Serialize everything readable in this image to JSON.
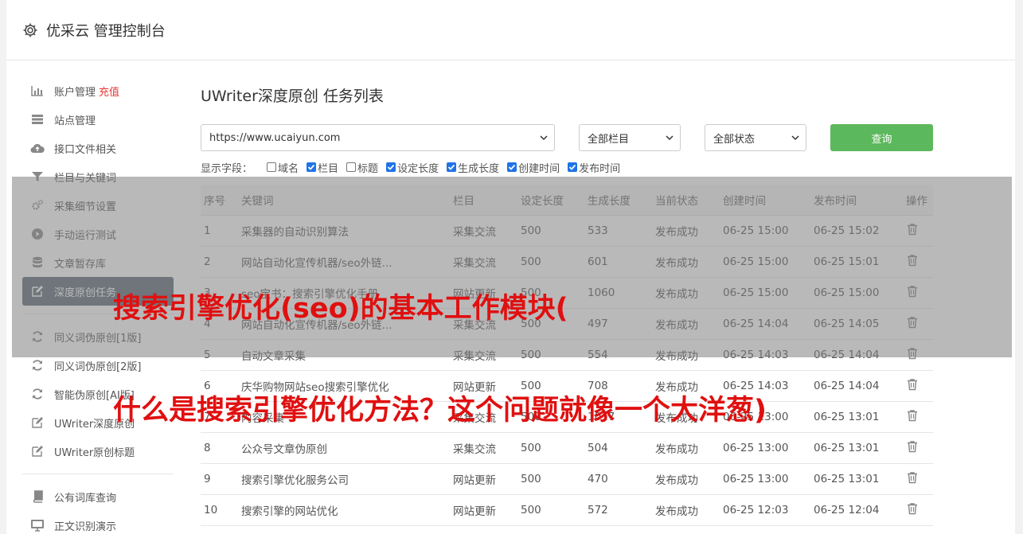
{
  "header": {
    "title": "优采云 管理控制台"
  },
  "sidebar": {
    "items": [
      {
        "label": "账户管理",
        "badge": "充值",
        "icon": "bar-chart-icon"
      },
      {
        "label": "站点管理",
        "icon": "server-icon"
      },
      {
        "label": "接口文件相关",
        "icon": "cloud-upload-icon"
      },
      {
        "label": "栏目与关键词",
        "icon": "filter-icon"
      },
      {
        "label": "采集细节设置",
        "icon": "gears-icon"
      },
      {
        "label": "手动运行测试",
        "icon": "play-icon"
      },
      {
        "label": "文章暂存库",
        "icon": "database-icon"
      },
      {
        "label": "深度原创任务",
        "icon": "edit-icon"
      }
    ],
    "items2": [
      {
        "label": "同义词伪原创[1版]",
        "icon": "refresh-icon"
      },
      {
        "label": "同义词伪原创[2版]",
        "icon": "refresh-icon"
      },
      {
        "label": "智能伪原创[AI版]",
        "icon": "refresh-icon"
      },
      {
        "label": "UWriter深度原创",
        "icon": "edit-icon"
      },
      {
        "label": "UWriter原创标题",
        "icon": "edit-icon"
      }
    ],
    "items3": [
      {
        "label": "公有词库查询",
        "icon": "book-icon"
      },
      {
        "label": "正文识别演示",
        "icon": "monitor-icon"
      }
    ]
  },
  "main": {
    "title": "UWriter深度原创 任务列表",
    "filters": {
      "site": "https://www.ucaiyun.com",
      "column": "全部栏目",
      "status": "全部状态",
      "query_label": "查询"
    },
    "fields": {
      "label": "显示字段：",
      "options": [
        {
          "label": "域名",
          "checked": false
        },
        {
          "label": "栏目",
          "checked": true
        },
        {
          "label": "标题",
          "checked": false
        },
        {
          "label": "设定长度",
          "checked": true
        },
        {
          "label": "生成长度",
          "checked": true
        },
        {
          "label": "创建时间",
          "checked": true
        },
        {
          "label": "发布时间",
          "checked": true
        }
      ]
    },
    "table": {
      "headers": [
        "序号",
        "关键词",
        "栏目",
        "设定长度",
        "生成长度",
        "当前状态",
        "创建时间",
        "发布时间",
        "操作"
      ],
      "rows": [
        [
          "1",
          "采集器的自动识别算法",
          "采集交流",
          "500",
          "533",
          "发布成功",
          "06-25 15:00",
          "06-25 15:02"
        ],
        [
          "2",
          "网站自动化宣传机器/seo外链...",
          "采集交流",
          "500",
          "601",
          "发布成功",
          "06-25 15:00",
          "06-25 15:01"
        ],
        [
          "3",
          "seo宝书：搜索引擎优化手册",
          "网站更新",
          "500",
          "1060",
          "发布成功",
          "06-25 15:00",
          "06-25 15:00"
        ],
        [
          "4",
          "网站自动化宣传机器/seo外链...",
          "采集交流",
          "500",
          "497",
          "发布成功",
          "06-25 14:04",
          "06-25 14:05"
        ],
        [
          "5",
          "自动文章采集",
          "采集交流",
          "500",
          "554",
          "发布成功",
          "06-25 14:03",
          "06-25 14:04"
        ],
        [
          "6",
          "庆华购物网站seo搜索引擎优化",
          "网站更新",
          "500",
          "708",
          "发布成功",
          "06-25 14:03",
          "06-25 14:04"
        ],
        [
          "7",
          "内容采集",
          "采集交流",
          "500",
          "1017",
          "发布成功",
          "06-25 13:00",
          "06-25 13:01"
        ],
        [
          "8",
          "公众号文章伪原创",
          "采集交流",
          "500",
          "504",
          "发布成功",
          "06-25 13:00",
          "06-25 13:01"
        ],
        [
          "9",
          "搜索引擎优化服务公司",
          "网站更新",
          "500",
          "470",
          "发布成功",
          "06-25 13:00",
          "06-25 13:01"
        ],
        [
          "10",
          "搜索引擎的网站优化",
          "网站更新",
          "500",
          "572",
          "发布成功",
          "06-25 12:03",
          "06-25 12:04"
        ]
      ]
    }
  },
  "overlay": {
    "line1": "搜索引擎优化(seo)的基本工作模块(",
    "line2": "什么是搜索引擎优化方法？这个问题就像一个大洋葱)"
  },
  "colors": {
    "accent_green": "#5cb85c",
    "active_nav": "#5c6977",
    "status_ok": "#3c9a3c",
    "overlay_text": "#e01010"
  }
}
